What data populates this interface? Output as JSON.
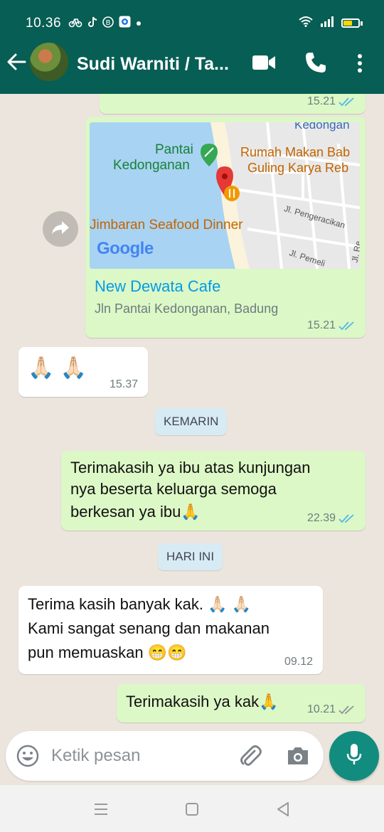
{
  "status": {
    "time": "10.36",
    "notification_icons": [
      "bike-icon",
      "tiktok-icon",
      "b-circle-icon",
      "app-icon"
    ],
    "battery_color": "#ffd600"
  },
  "appbar": {
    "contact_name": "Sudi Warniti / Ta...",
    "bg_color": "#075e54"
  },
  "messages": {
    "top_partial": {
      "time": "15.21"
    },
    "location": {
      "place_name": "New Dewata Cafe",
      "address": "Jln Pantai Kedonganan, Badung",
      "time": "15.21",
      "map": {
        "labels": {
          "kedongan": "Kedongan",
          "pantai": "Pantai",
          "kedonganan": "Kedonganan",
          "rumah_makan_1": "Rumah Makan Bab",
          "rumah_makan_2": "Guling Karya Reb",
          "jimbaran": "Jimbaran Seafood Dinner",
          "jl_pengeracikan": "Jl. Pengeracikan",
          "jl_pemeli": "Jl. Pemeli",
          "jl_re": "Jl. Re",
          "google": "Google"
        }
      }
    },
    "pray_in": {
      "text": "🙏🏻 🙏🏻",
      "time": "15.37"
    },
    "date_yesterday": "KEMARIN",
    "thanks_out": {
      "line1": "Terimakasih ya ibu atas kunjungan",
      "line2": "nya beserta keluarga semoga",
      "line3": "berkesan ya ibu🙏",
      "time": "22.39"
    },
    "date_today": "HARI INI",
    "reply_in": {
      "line1": "Terima kasih banyak kak. 🙏🏻 🙏🏻",
      "line2": "Kami sangat senang dan makanan",
      "line3": "pun memuaskan 😁😁",
      "time": "09.12"
    },
    "last_out": {
      "text": "Terimakasih ya kak🙏",
      "time": "10.21"
    }
  },
  "input": {
    "placeholder": "Ketik pesan"
  },
  "colors": {
    "outgoing": "#dcf8c6",
    "incoming": "#ffffff",
    "read_ticks": "#4fb6ec",
    "delivered_ticks": "#8c9296",
    "mic": "#128c7e"
  }
}
